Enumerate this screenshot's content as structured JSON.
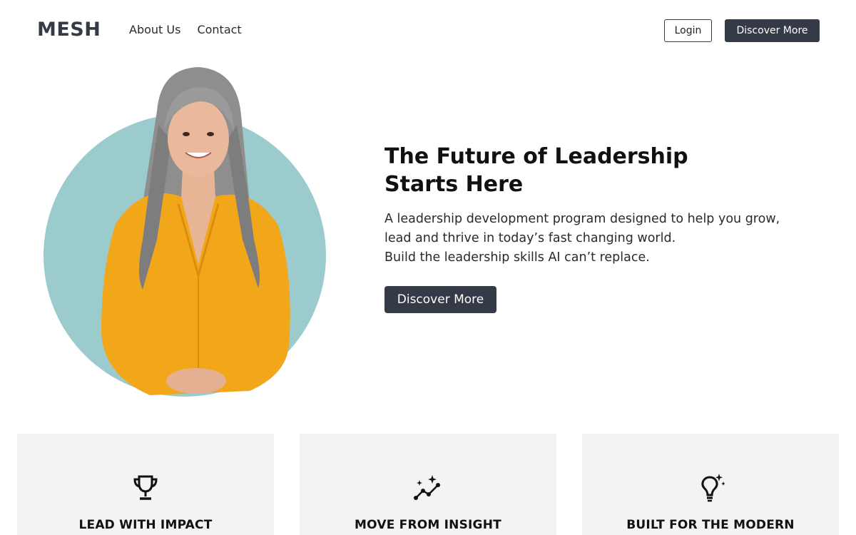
{
  "header": {
    "logo": "MESH",
    "nav": [
      {
        "label": "About Us"
      },
      {
        "label": "Contact"
      }
    ],
    "login_label": "Login",
    "discover_label": "Discover More"
  },
  "hero": {
    "title_line1": "The Future of Leadership",
    "title_line2": "Starts Here",
    "subtitle_line1": "A leadership development program designed to help you grow,",
    "subtitle_line2": "lead and thrive in today’s fast changing world.",
    "subtitle_line3": "Build the leadership skills AI can’t replace.",
    "cta_label": "Discover More",
    "photo": {
      "circle_color": "#9ccbcd",
      "shirt_color": "#f2a71b"
    }
  },
  "cards": [
    {
      "icon": "trophy-icon",
      "title": "LEAD WITH IMPACT"
    },
    {
      "icon": "sparkle-trend-icon",
      "title": "MOVE FROM INSIGHT"
    },
    {
      "icon": "lightbulb-icon",
      "title": "BUILT FOR THE MODERN"
    }
  ],
  "colors": {
    "primary": "#353a47",
    "card_bg": "#f3f3f3"
  }
}
